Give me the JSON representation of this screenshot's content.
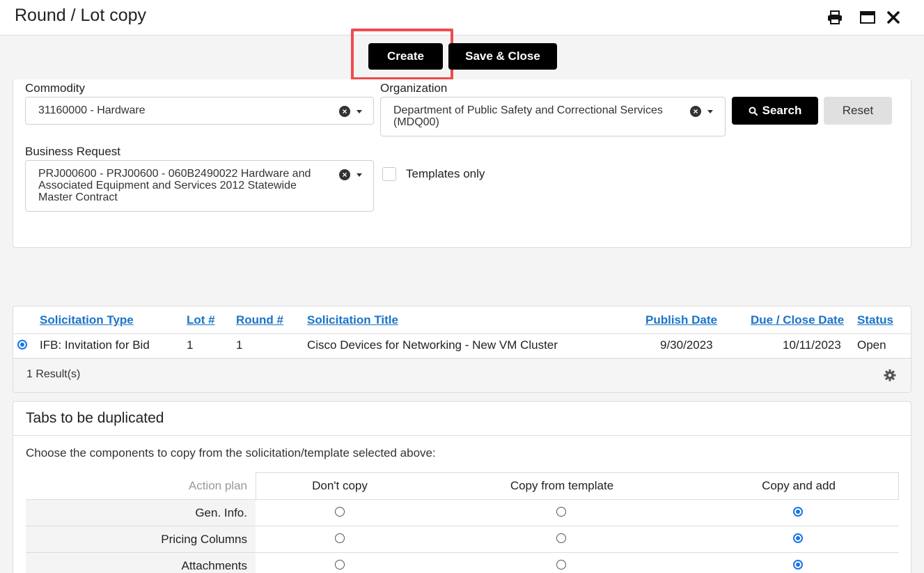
{
  "window": {
    "title": "Round / Lot copy",
    "print_icon": "print-icon",
    "maximize_icon": "maximize-icon",
    "close_icon": "close-icon"
  },
  "actions": {
    "create_label": "Create",
    "save_close_label": "Save & Close"
  },
  "filters": {
    "commodity": {
      "label": "Commodity",
      "value": "31160000 - Hardware"
    },
    "organization": {
      "label": "Organization",
      "value": "Department of Public Safety and Correctional Services (MDQ00)"
    },
    "business_request": {
      "label": "Business Request",
      "value": "PRJ000600 - PRJ00600 - 060B2490022 Hardware and Associated Equipment and Services 2012 Statewide Master Contract"
    },
    "templates_only": {
      "label": "Templates only",
      "checked": false
    },
    "search_label": "Search",
    "reset_label": "Reset"
  },
  "results": {
    "columns": [
      "Solicitation Type",
      "Lot #",
      "Round #",
      "Solicitation Title",
      "Publish Date",
      "Due / Close Date",
      "Status"
    ],
    "rows": [
      {
        "selected": true,
        "type": "IFB: Invitation for Bid",
        "lot": "1",
        "round": "1",
        "title": "Cisco Devices for Networking - New VM Cluster",
        "publish_date": "9/30/2023",
        "due_date": "10/11/2023",
        "status": "Open"
      }
    ],
    "count_label": "1 Result(s)",
    "settings_icon": "gear-icon"
  },
  "tabs_section": {
    "title": "Tabs to be duplicated",
    "description": "Choose the components to copy from the solicitation/template selected above:",
    "corner_label": "Action plan",
    "options": [
      "Don't copy",
      "Copy from template",
      "Copy and add"
    ],
    "rows": [
      {
        "label": "Gen. Info.",
        "selected": "Copy and add"
      },
      {
        "label": "Pricing Columns",
        "selected": "Copy and add"
      },
      {
        "label": "Attachments",
        "selected": "Copy and add"
      }
    ]
  },
  "colors": {
    "link": "#1a73c9",
    "primary_button": "#000000",
    "highlight": "#ee4b4f",
    "radio_selected": "#1a73e8"
  }
}
